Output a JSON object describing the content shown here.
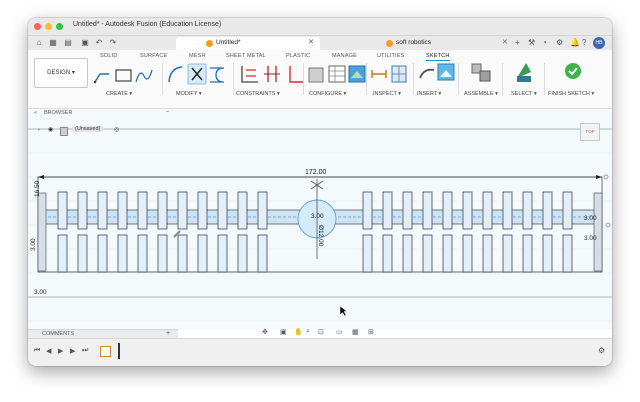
{
  "window": {
    "title": "Untitled* - Autodesk Fusion (Education License)"
  },
  "tabs": [
    {
      "label": "Untitled*",
      "active": true
    },
    {
      "label": "soft robotics",
      "active": false
    }
  ],
  "user_initials": "HB",
  "mode_tabs": [
    "SOLID",
    "SURFACE",
    "MESH",
    "SHEET METAL",
    "PLASTIC",
    "MANAGE",
    "UTILITIES",
    "SKETCH"
  ],
  "active_mode_tab": "SKETCH",
  "workspace_button": "DESIGN ▾",
  "tool_groups": [
    {
      "label": "CREATE ▾"
    },
    {
      "label": "MODIFY ▾"
    },
    {
      "label": "CONSTRAINTS ▾"
    },
    {
      "label": "CONFIGURE ▾"
    },
    {
      "label": "INSPECT ▾"
    },
    {
      "label": "INSERT ▾"
    },
    {
      "label": "ASSEMBLE ▾"
    },
    {
      "label": "SELECT ▾"
    },
    {
      "label": "FINISH SKETCH ▾"
    }
  ],
  "browser": {
    "title": "BROWSER",
    "root_label": "(Unsaved)"
  },
  "viewcube_label": "TOP",
  "comments": {
    "title": "COMMENTS"
  },
  "dimensions": {
    "overall_width": "172.00",
    "left_height": "16.50",
    "left_small": "3.00",
    "bottom_left": "3.00",
    "center_top": "3.00",
    "center_diameter": "Ø12.00",
    "right_top": "3.00",
    "right_mid": "3.00",
    "far_left": "3.00"
  },
  "colors": {
    "accent": "#0696d7",
    "sketch_line": "#1e1e1e",
    "dimension": "#222222",
    "finish_green": "#3ab54a",
    "canvas_bg": "#f4f9fc"
  }
}
